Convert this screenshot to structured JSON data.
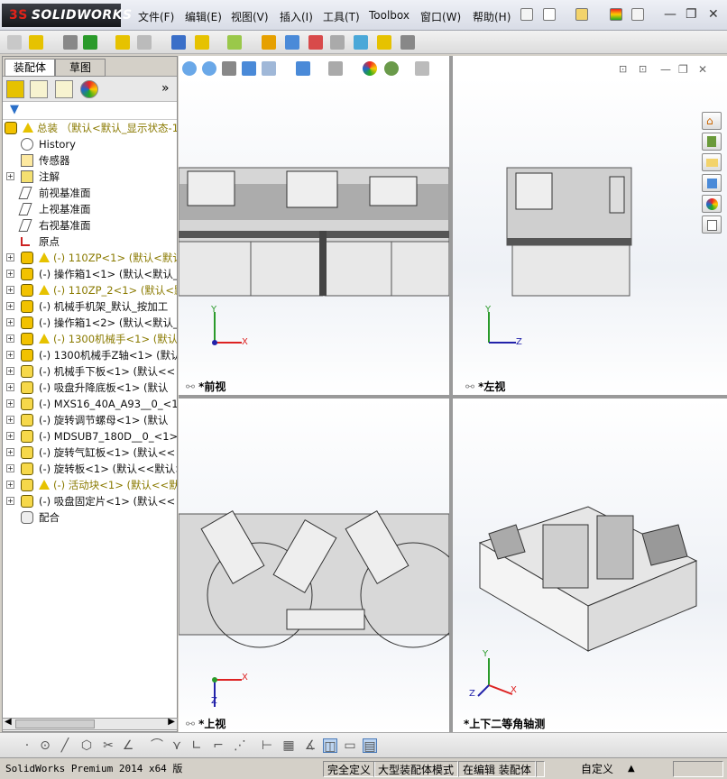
{
  "app": {
    "logo_prefix": "3S",
    "logo_text": "SOLIDWORKS"
  },
  "menu": [
    "文件(F)",
    "编辑(E)",
    "视图(V)",
    "插入(I)",
    "工具(T)",
    "Toolbox",
    "窗口(W)",
    "帮助(H)"
  ],
  "tabs": {
    "assembly": "装配体",
    "sketch": "草图"
  },
  "tree": {
    "root": "总装  （默认<默认_显示状态-1",
    "items": [
      {
        "label": "History",
        "type": "history",
        "expand": false,
        "warn": false
      },
      {
        "label": "传感器",
        "type": "sensor",
        "expand": false,
        "warn": false
      },
      {
        "label": "注解",
        "type": "note",
        "expand": true,
        "warn": false
      },
      {
        "label": "前视基准面",
        "type": "plane",
        "expand": false,
        "warn": false
      },
      {
        "label": "上视基准面",
        "type": "plane",
        "expand": false,
        "warn": false
      },
      {
        "label": "右视基准面",
        "type": "plane",
        "expand": false,
        "warn": false
      },
      {
        "label": "原点",
        "type": "origin",
        "expand": false,
        "warn": false
      },
      {
        "label": "(-) 110ZP<1> (默认<默认>",
        "type": "asm",
        "expand": true,
        "warn": true
      },
      {
        "label": "(-) 操作箱1<1> (默认<默认_",
        "type": "asm",
        "expand": true,
        "warn": false
      },
      {
        "label": "(-) 110ZP_2<1> (默认<默认",
        "type": "asm",
        "expand": true,
        "warn": true
      },
      {
        "label": "(-) 机械手机架_默认_按加工",
        "type": "asm",
        "expand": true,
        "warn": false
      },
      {
        "label": "(-) 操作箱1<2> (默认<默认_",
        "type": "asm",
        "expand": true,
        "warn": false
      },
      {
        "label": "(-) 1300机械手<1> (默认<默",
        "type": "asm",
        "expand": true,
        "warn": true
      },
      {
        "label": "(-) 1300机械手Z轴<1> (默认",
        "type": "asm",
        "expand": true,
        "warn": false
      },
      {
        "label": "(-) 机械手下板<1> (默认<<",
        "type": "part",
        "expand": true,
        "warn": false
      },
      {
        "label": "(-) 吸盘升降底板<1> (默认",
        "type": "part",
        "expand": true,
        "warn": false
      },
      {
        "label": "(-) MXS16_40A_A93__0_<1> (",
        "type": "part",
        "expand": true,
        "warn": false
      },
      {
        "label": "(-) 旋转调节螺母<1> (默认",
        "type": "part",
        "expand": true,
        "warn": false
      },
      {
        "label": "(-) MDSUB7_180D__0_<1> (默",
        "type": "part",
        "expand": true,
        "warn": false
      },
      {
        "label": "(-) 旋转气缸板<1> (默认<<",
        "type": "part",
        "expand": true,
        "warn": false
      },
      {
        "label": "(-) 旋转板<1> (默认<<默认>",
        "type": "part",
        "expand": true,
        "warn": false
      },
      {
        "label": "(-) 活动块<1> (默认<<默",
        "type": "part",
        "expand": true,
        "warn": true
      },
      {
        "label": "(-) 吸盘固定片<1> (默认<<",
        "type": "part",
        "expand": true,
        "warn": false
      },
      {
        "label": "配合",
        "type": "mate",
        "expand": false,
        "warn": false
      }
    ]
  },
  "views": {
    "front": "*前视",
    "left": "*左视",
    "top": "*上视",
    "iso": "*上下二等角轴测"
  },
  "axes": {
    "x": "X",
    "y": "Y",
    "z": "Z"
  },
  "status": {
    "product": "SolidWorks Premium 2014 x64 版",
    "s1": "完全定义",
    "s2": "大型装配体模式",
    "s3": "在编辑 装配体",
    "s4": "自定义"
  }
}
